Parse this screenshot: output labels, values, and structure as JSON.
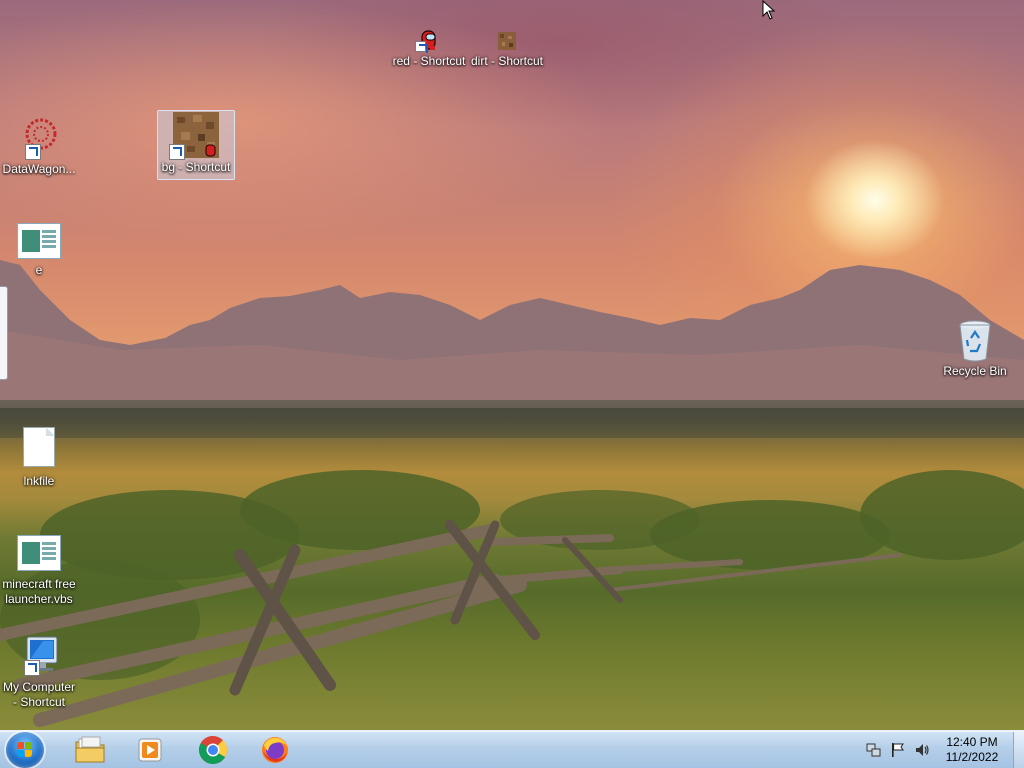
{
  "desktop": {
    "icons": [
      {
        "label": "red - Shortcut",
        "icon": "red-character-icon"
      },
      {
        "label": "dirt - Shortcut",
        "icon": "dirt-block-icon"
      },
      {
        "label": "DataWagon...",
        "icon": "datawagon-icon"
      },
      {
        "label": "bg - Shortcut",
        "icon": "dirt-image-icon"
      },
      {
        "label": "e",
        "icon": "script-file-icon"
      },
      {
        "label": "Recycle Bin",
        "icon": "recycle-bin-icon"
      },
      {
        "label": "lnkfile",
        "icon": "blank-document-icon"
      },
      {
        "label": "minecraft free launcher.vbs",
        "icon": "script-file-icon"
      },
      {
        "label": "My Computer - Shortcut",
        "icon": "computer-icon"
      }
    ]
  },
  "taskbar": {
    "start": {
      "icon": "windows-start-icon"
    },
    "pinned": [
      {
        "name": "File Explorer",
        "icon": "folder-icon"
      },
      {
        "name": "Windows Media Player",
        "icon": "media-player-icon"
      },
      {
        "name": "Google Chrome",
        "icon": "chrome-icon"
      },
      {
        "name": "Firefox",
        "icon": "firefox-icon"
      }
    ],
    "tray": {
      "icons": [
        "network-icon",
        "flag-icon",
        "volume-icon"
      ],
      "time": "12:40 PM",
      "date": "11/2/2022"
    }
  }
}
